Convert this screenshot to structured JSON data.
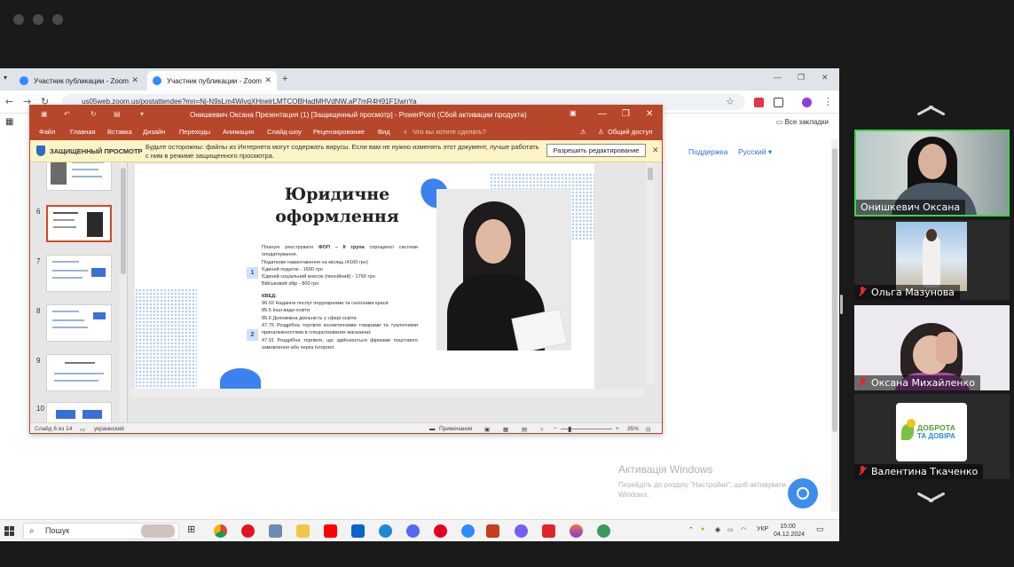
{
  "browser": {
    "tabs": [
      {
        "title": "Участник публикации - Zoom"
      },
      {
        "title": "Участник публикации - Zoom"
      }
    ],
    "url": "us05web.zoom.us/postattendee?mn=Nj-N9sLm4WivqXHnelrLMTCOBHadMHVdNW.aP7mR4H91F1IwnYa",
    "bookmarks_all": "Все закладки",
    "page_links": [
      "Поддержка",
      "Русский ▾"
    ]
  },
  "powerpoint": {
    "window_title": "Онишкевич Оксана Презентация (1) [Защищенный просмотр] - PowerPoint (Сбой активации продукта)",
    "ribbon": [
      "Файл",
      "Главная",
      "Вставка",
      "Дизайн",
      "Переходы",
      "Анимация",
      "Слайд-шоу",
      "Рецензирование",
      "Вид"
    ],
    "tell_me": "Что вы хотите сделать?",
    "share": "Общий доступ",
    "protected_view": {
      "title": "ЗАЩИЩЕННЫЙ ПРОСМОТР",
      "message": "Будьте осторожны: файлы из Интернета могут содержать вирусы. Если вам не нужно изменять этот документ, лучше работать с ним в режиме защищенного просмотра.",
      "enable_button": "Разрешить редактирование"
    },
    "thumbnails": [
      {
        "num": "6",
        "selected": true
      },
      {
        "num": "7"
      },
      {
        "num": "8"
      },
      {
        "num": "9"
      },
      {
        "num": "10"
      }
    ],
    "slide": {
      "title_line1": "Юридичне",
      "title_line2": "оформлення",
      "badge1": "1",
      "badge2": "2",
      "intro_a": "Планую реєструвати ",
      "intro_b": "ФОП – ІІ група",
      "intro_c": " спрощеної системи оподаткування.",
      "tax_lines": [
        "Податкове навантаження на місяць (4160 грн)",
        "Єдиний податок - 1600 грн",
        "Єдиний соціальний внесок (пенсійний) - 1760 грн",
        "Військовий збір - 800 грн"
      ],
      "kved_label": "КВЕД:",
      "kved_lines": [
        "96.02 Надання послуг перукарнями та салонами краси",
        "85.5 Інші види освіти",
        "85.6 Допоміжна діяльність у сфері освіти",
        "47.75 Роздрібна торгівля косметичними товарами та туалетними приналежностями в спеціалізованих магазинах",
        "47.91 Роздрібна торгівля, що здійснюється фірмами поштового замовлення або через Інтернет."
      ]
    },
    "status": {
      "slide_of": "Слайд 6 из 14",
      "language": "украинский",
      "notes": "Примечания",
      "zoom_level": "35%"
    }
  },
  "windows_activation": {
    "title": "Активація Windows",
    "text": "Перейдіть до розділу \"Настройки\", щоб активувати Windows."
  },
  "taskbar": {
    "search_placeholder": "Пошук",
    "lang": "УКР",
    "time": "15:00",
    "date": "04.12.2024"
  },
  "participants": [
    {
      "name": "Онишкевич Оксана",
      "active": true,
      "muted": false
    },
    {
      "name": "Ольга Мазунова",
      "muted": true
    },
    {
      "name": "Оксана Михайленко",
      "muted": true
    },
    {
      "name": "Валентина Ткаченко",
      "muted": true,
      "avatar_line1": "ДОБРОТА",
      "avatar_line2": "ТА ДОВІРА"
    }
  ],
  "colors": {
    "powerpoint_accent": "#b7472a",
    "active_speaker": "#3ed34a",
    "zoom_blue": "#2d8cff",
    "muted_red": "#e02828"
  }
}
